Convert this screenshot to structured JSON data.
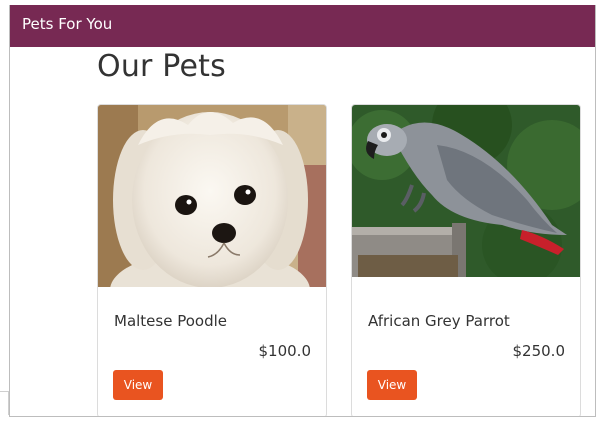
{
  "navbar": {
    "brand": "Pets For You"
  },
  "page": {
    "title": "Our Pets"
  },
  "pets": [
    {
      "name": "Maltese Poodle",
      "price": "$100.0",
      "button": "View",
      "image_icon": "maltese-poodle-photo"
    },
    {
      "name": "African Grey Parrot",
      "price": "$250.0",
      "button": "View",
      "image_icon": "african-grey-parrot-photo"
    }
  ],
  "colors": {
    "navbar": "#772953",
    "button": "#e95420",
    "text": "#333333",
    "card_border": "#dcdcdc"
  }
}
